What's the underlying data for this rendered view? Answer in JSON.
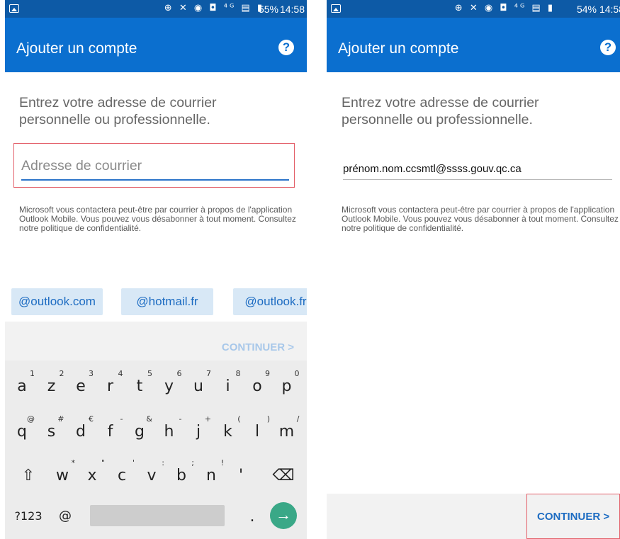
{
  "left": {
    "status": {
      "icons": "⊕ ✕ ◉ ◘ ⁴ᴳ ▤ ▮",
      "battery": "55%",
      "time": "14:58"
    },
    "appbar": {
      "title": "Ajouter un compte",
      "help": "?"
    },
    "prompt": "Entrez votre adresse de courrier personnelle ou professionnelle.",
    "email": {
      "placeholder": "Adresse de courrier",
      "value": ""
    },
    "disclaimer": "Microsoft vous contactera peut-être par courrier à propos de l'application Outlook Mobile. Vous pouvez vous désabonner à tout moment. Consultez notre politique de confidentialité.",
    "suggestions": [
      "@outlook.com",
      "@hotmail.fr",
      "@outlook.fr"
    ],
    "continue": "CONTINUER >",
    "keyboard": {
      "row1": [
        [
          "a",
          "1"
        ],
        [
          "z",
          "2"
        ],
        [
          "e",
          "3"
        ],
        [
          "r",
          "4"
        ],
        [
          "t",
          "5"
        ],
        [
          "y",
          "6"
        ],
        [
          "u",
          "7"
        ],
        [
          "i",
          "8"
        ],
        [
          "o",
          "9"
        ],
        [
          "p",
          "0"
        ]
      ],
      "row2": [
        [
          "q",
          "@"
        ],
        [
          "s",
          "#"
        ],
        [
          "d",
          "€"
        ],
        [
          "f",
          "-"
        ],
        [
          "g",
          "&"
        ],
        [
          "h",
          "-"
        ],
        [
          "j",
          "+"
        ],
        [
          "k",
          "("
        ],
        [
          "l",
          ")"
        ],
        [
          "m",
          "/"
        ]
      ],
      "row3": [
        [
          "w",
          "*"
        ],
        [
          "x",
          "\""
        ],
        [
          "c",
          "'"
        ],
        [
          "v",
          ":"
        ],
        [
          "b",
          ";"
        ],
        [
          "n",
          "!"
        ],
        [
          "'",
          ""
        ]
      ],
      "shift": "⇧",
      "backspace": "⌫",
      "symbols": "?123",
      "at": "@",
      "period": ".",
      "enter": "→"
    }
  },
  "right": {
    "status": {
      "icons": "⊕ ✕ ◉ ◘ ⁴ᴳ ▤ ▮",
      "battery": "54%",
      "time": "14:58"
    },
    "appbar": {
      "title": "Ajouter un compte",
      "help": "?"
    },
    "prompt": "Entrez votre adresse de courrier personnelle ou professionnelle.",
    "email": {
      "value": "prénom.nom.ccsmtl@ssss.gouv.qc.ca"
    },
    "disclaimer": "Microsoft vous contactera peut-être par courrier à propos de l'application Outlook Mobile. Vous pouvez vous désabonner à tout moment. Consultez notre politique de confidentialité.",
    "continue": "CONTINUER >"
  },
  "colors": {
    "statusbar": "#0d5aa6",
    "appbar": "#0b6fcf",
    "highlight": "#e3606a",
    "chip": "#d8e8f6",
    "enter": "#3aa887"
  }
}
